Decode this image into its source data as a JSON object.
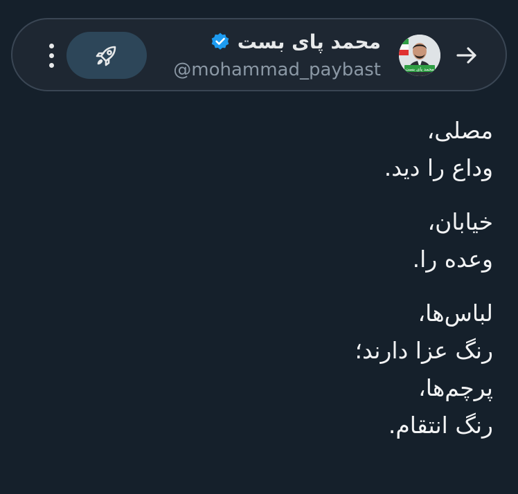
{
  "header": {
    "display_name": "محمد پای بست",
    "handle": "@mohammad_paybast",
    "avatar_caption": "محمد پای بست",
    "icons": {
      "back": "arrow-right-icon",
      "verified": "verified-badge-icon",
      "boost": "rocket-icon",
      "more": "more-vertical-icon"
    }
  },
  "post": {
    "stanzas": [
      {
        "lines": [
          "مصلی،",
          "وداع را دید."
        ]
      },
      {
        "lines": [
          "خیابان،",
          "وعده را."
        ]
      },
      {
        "lines": [
          "لباس‌ها،",
          "رنگ عزا دارند؛",
          "پرچم‌ها،",
          "رنگ انتقام."
        ]
      }
    ]
  },
  "colors": {
    "background": "#15202b",
    "header_background": "#1e2732",
    "header_border": "#3a4654",
    "verified_blue": "#1d9bf0",
    "boost_button": "#2d4659",
    "muted_text": "#8b98a5"
  }
}
